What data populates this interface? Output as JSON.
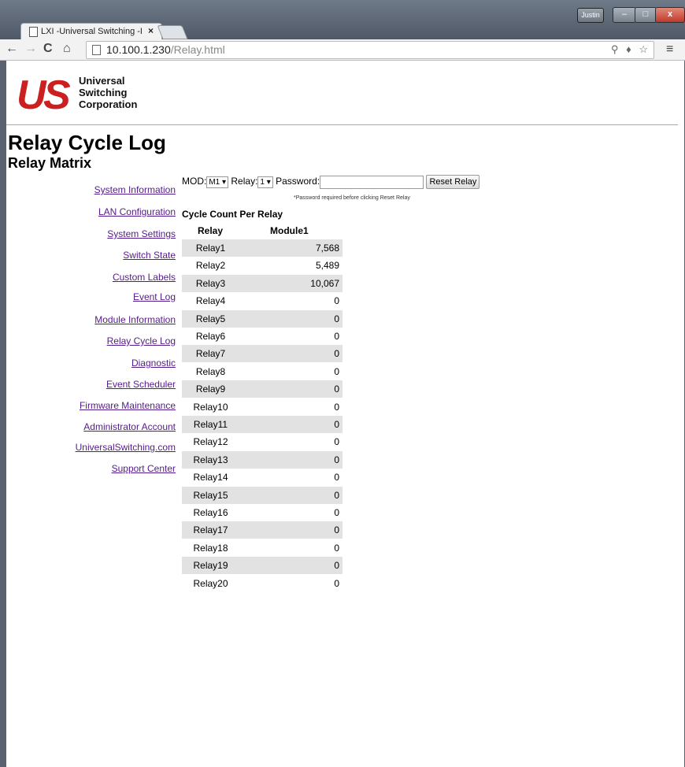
{
  "browser": {
    "tab_title": "LXI -Universal Switching -I",
    "tab_close": "×",
    "user_name": "Justin",
    "url_host": "10.100.1.230",
    "url_path": "/Relay.html",
    "win_min": "–",
    "win_max": "□",
    "win_close": "x",
    "nav_back": "←",
    "nav_forward": "→",
    "nav_reload": "C",
    "nav_home": "⌂",
    "omni_icons": "⚲ ♦ ☆",
    "menu": "≡"
  },
  "logo": {
    "letter_u": "U",
    "letter_s": "S",
    "line1": "Universal",
    "line2": "Switching",
    "line3": "Corporation"
  },
  "page": {
    "title": "Relay Cycle Log",
    "subtitle": "Relay Matrix"
  },
  "nav": [
    "System Information",
    "LAN Configuration",
    "System Settings",
    "Switch State",
    "Custom Labels",
    "Event Log",
    "Module Information",
    "Relay Cycle Log",
    "Diagnostic",
    "Event Scheduler",
    "Firmware Maintenance",
    "Administrator Account",
    "UniversalSwitching.com",
    "Support Center"
  ],
  "controls": {
    "mod_label": "MOD:",
    "mod_value": "M1 ▾",
    "relay_label": "Relay:",
    "relay_value": "1 ▾",
    "password_label": "Password:",
    "password_value": "",
    "reset_button": "Reset Relay",
    "note": "*Password required before clicking Reset Relay"
  },
  "table": {
    "caption": "Cycle Count Per Relay",
    "headers": [
      "Relay",
      "Module1"
    ],
    "rows": [
      [
        "Relay1",
        "7,568"
      ],
      [
        "Relay2",
        "5,489"
      ],
      [
        "Relay3",
        "10,067"
      ],
      [
        "Relay4",
        "0"
      ],
      [
        "Relay5",
        "0"
      ],
      [
        "Relay6",
        "0"
      ],
      [
        "Relay7",
        "0"
      ],
      [
        "Relay8",
        "0"
      ],
      [
        "Relay9",
        "0"
      ],
      [
        "Relay10",
        "0"
      ],
      [
        "Relay11",
        "0"
      ],
      [
        "Relay12",
        "0"
      ],
      [
        "Relay13",
        "0"
      ],
      [
        "Relay14",
        "0"
      ],
      [
        "Relay15",
        "0"
      ],
      [
        "Relay16",
        "0"
      ],
      [
        "Relay17",
        "0"
      ],
      [
        "Relay18",
        "0"
      ],
      [
        "Relay19",
        "0"
      ],
      [
        "Relay20",
        "0"
      ]
    ]
  }
}
